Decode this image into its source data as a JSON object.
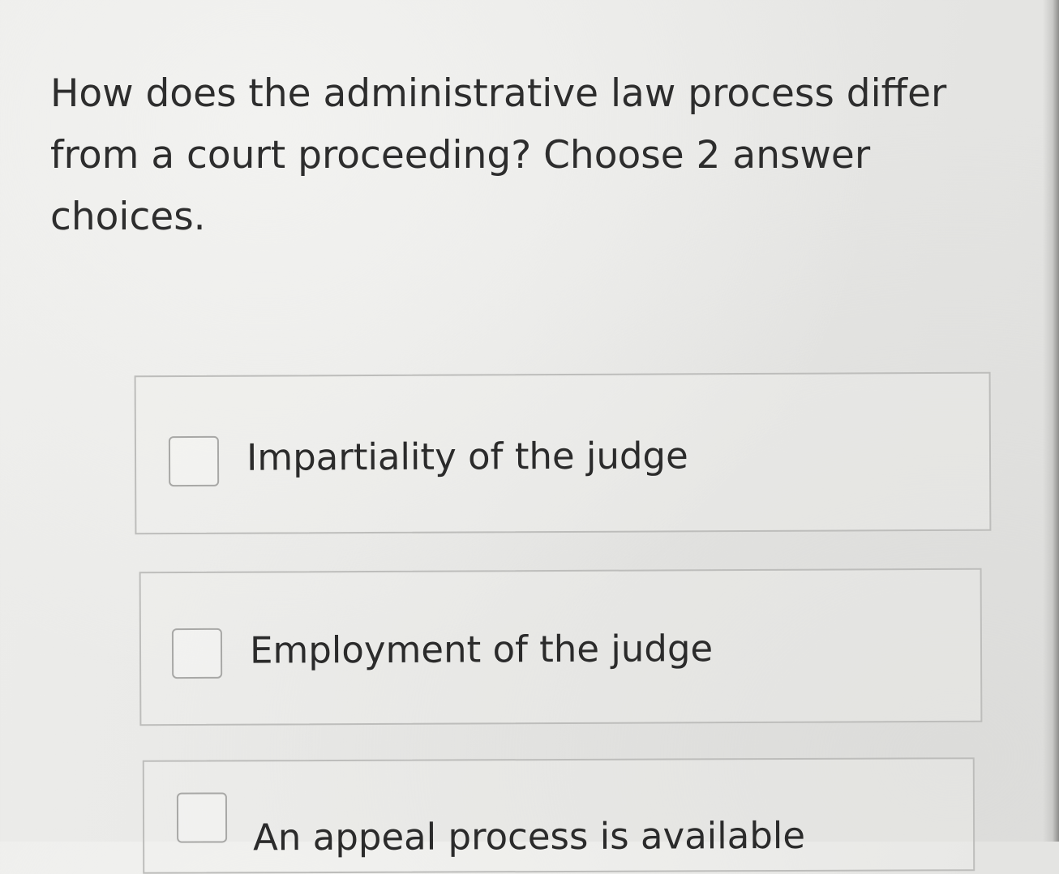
{
  "question": {
    "text": "How does the administrative law process differ from a court proceeding? Choose 2 answer choices."
  },
  "choices": [
    {
      "label": "Impartiality of the judge",
      "checked": false
    },
    {
      "label": "Employment of the judge",
      "checked": false
    },
    {
      "label": "An appeal process is available",
      "checked": false
    }
  ]
}
